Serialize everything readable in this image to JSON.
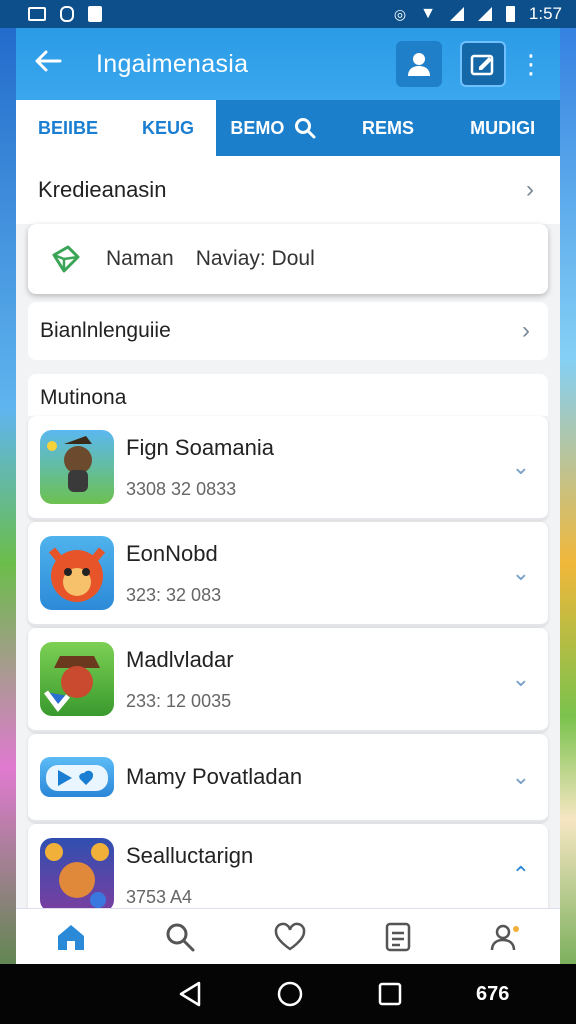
{
  "status": {
    "time": "1:57"
  },
  "appbar": {
    "title": "Ingaimenasia"
  },
  "tabs": [
    {
      "label": "BEIIBE"
    },
    {
      "label": "KEUG"
    },
    {
      "label": "BEMO"
    },
    {
      "label": "REMS"
    },
    {
      "label": "MUDIGI"
    }
  ],
  "rows": {
    "row1": "Kredieanasin",
    "card_left": "Naman",
    "card_right": "Naviay: Doul",
    "row2": "Bianlnlenguiie"
  },
  "section": {
    "title": "Mutinona"
  },
  "items": [
    {
      "name": "Fign Soamania",
      "sub": "3308 32 0833"
    },
    {
      "name": "EonNobd",
      "sub": "323: 32 083"
    },
    {
      "name": "Madlvladar",
      "sub": "233: 12 0035"
    },
    {
      "name": "Mamy Povatladan",
      "sub": ""
    },
    {
      "name": "Sealluctarign",
      "sub": "3753 A4"
    }
  ],
  "navbar": {
    "label": "676"
  },
  "icons": [
    "back-icon",
    "user-icon",
    "edit-icon",
    "more-icon",
    "search-icon",
    "home-icon",
    "heart-icon",
    "document-icon",
    "profile-icon"
  ],
  "colors": {
    "primary": "#2b9be6",
    "tab_bar": "#1b7fcb",
    "accent_active": "#1a7ed2"
  }
}
